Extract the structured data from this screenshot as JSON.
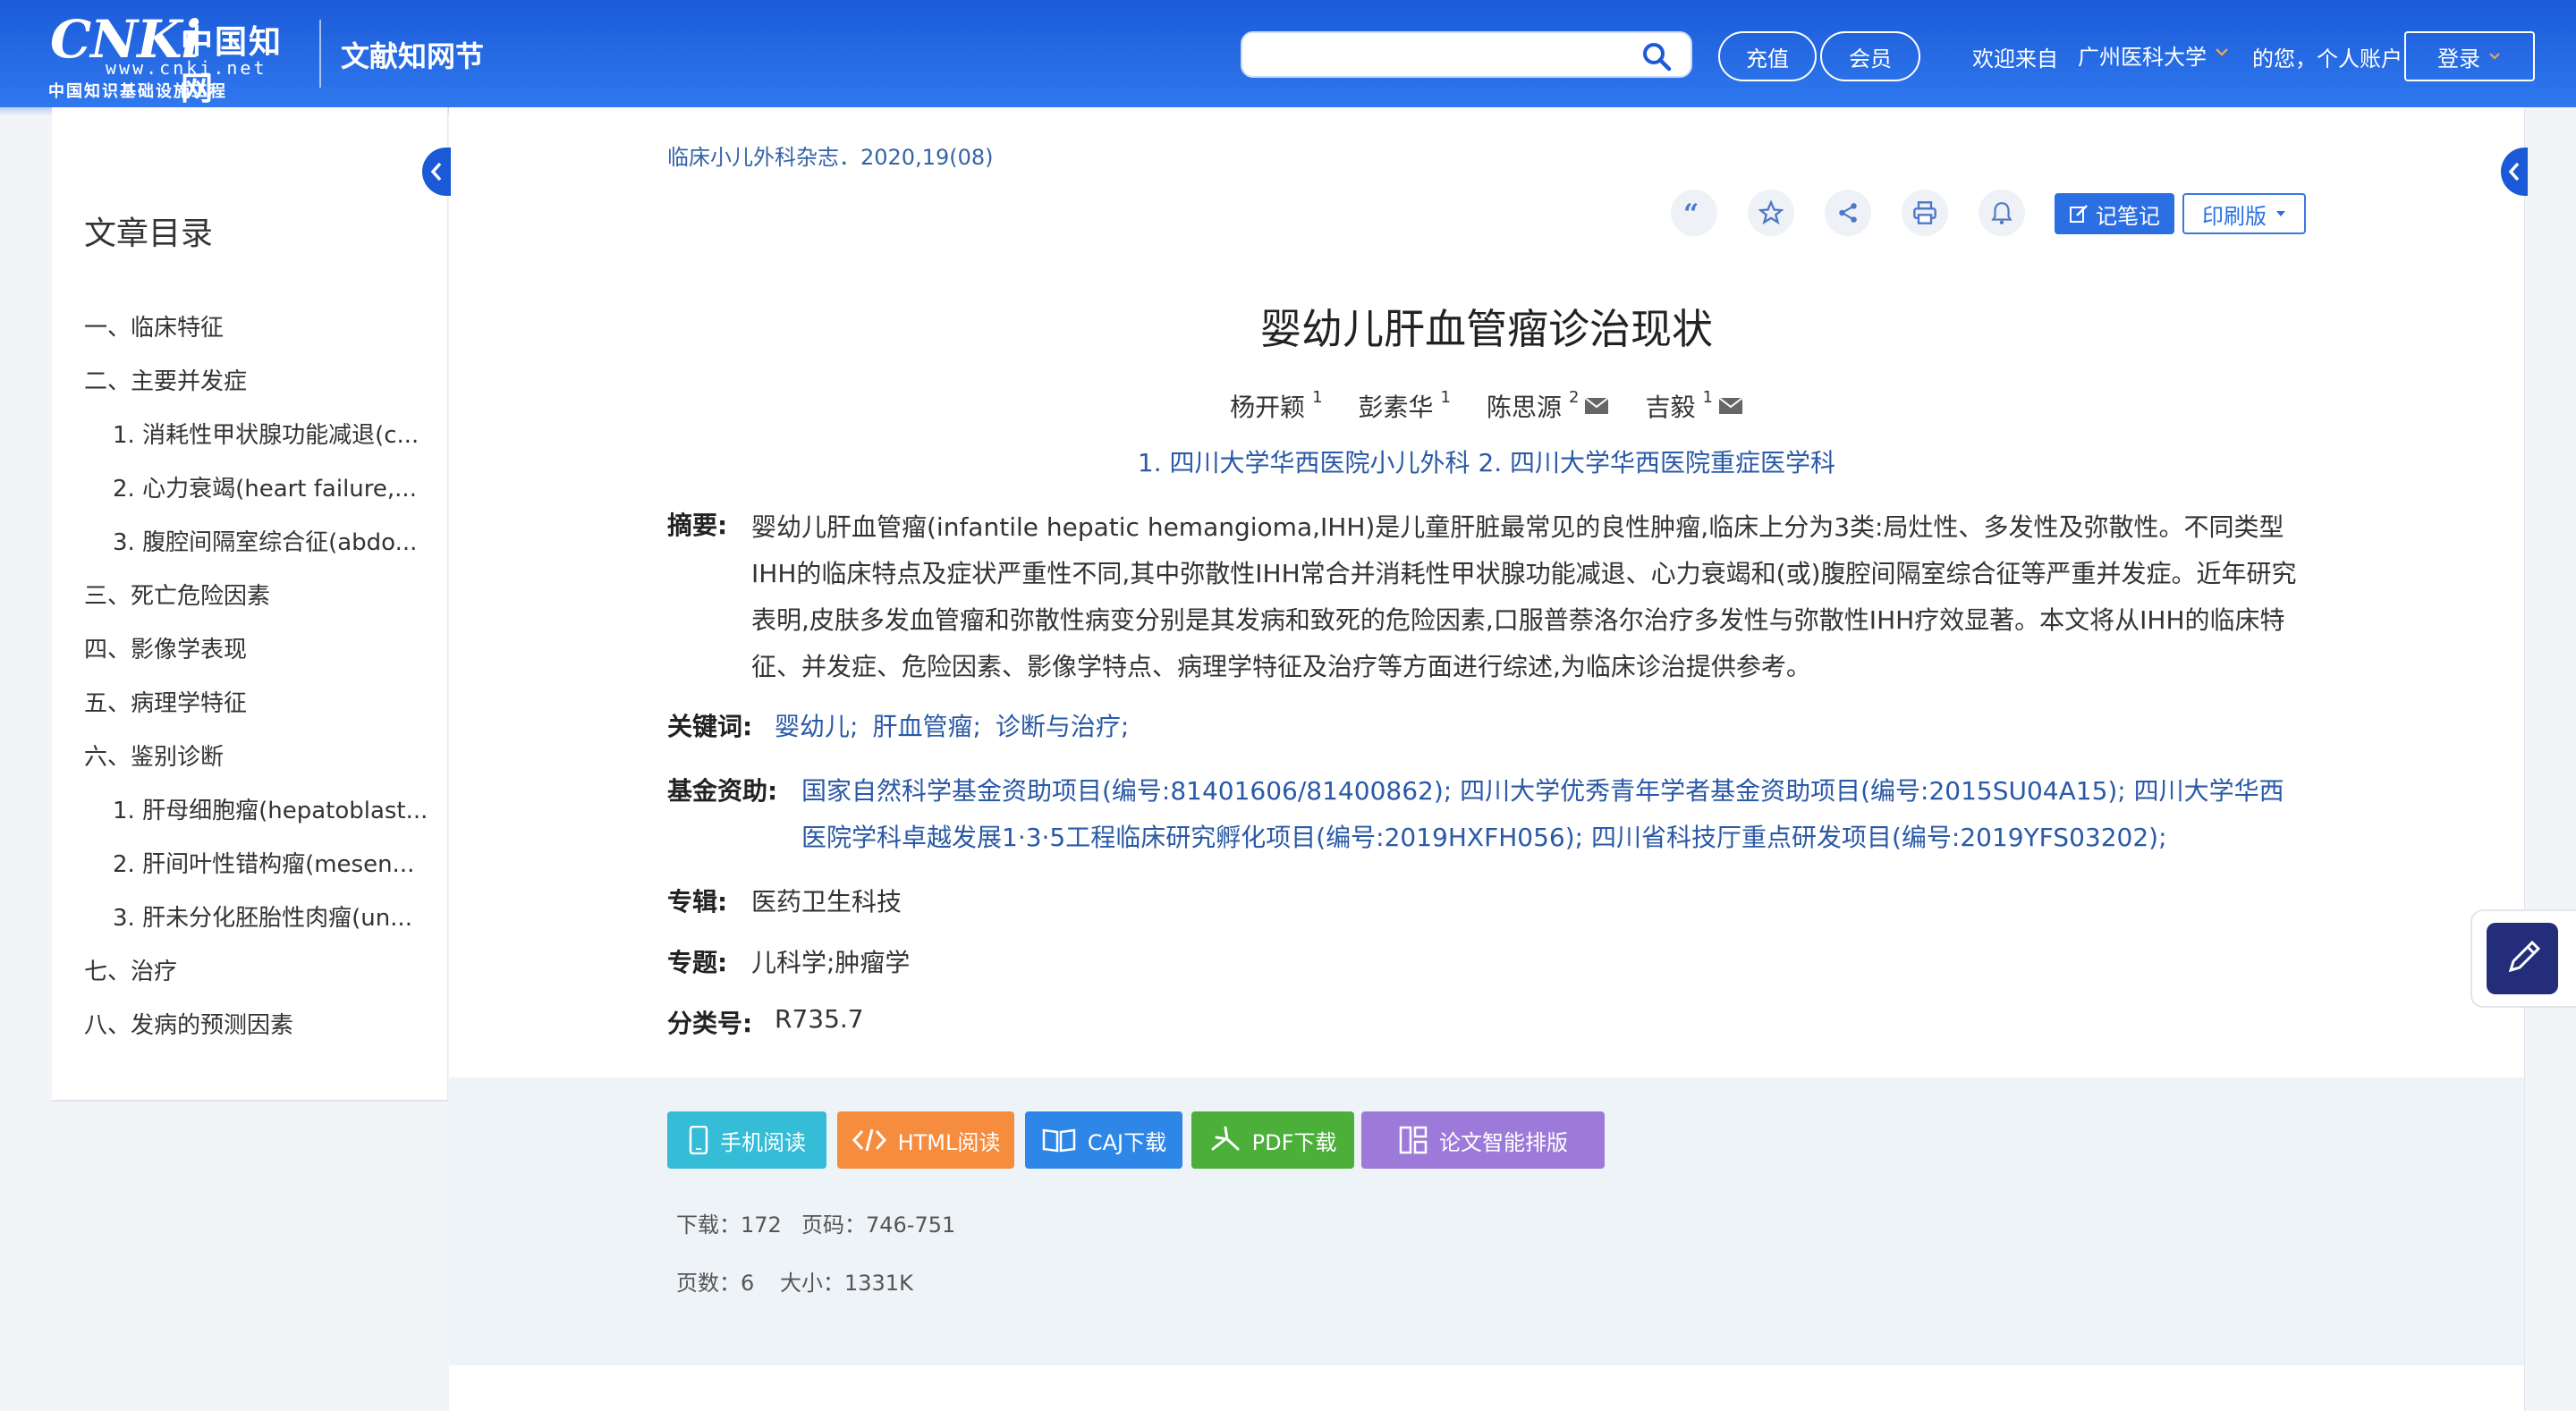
{
  "header": {
    "logo_text": "CNKi",
    "logo_cn": "中国知网",
    "logo_url": "www.cnki.net",
    "logo_sub": "中国知识基础设施工程",
    "site_name": "文献知网节",
    "search_placeholder": "",
    "recharge_label": "充值",
    "member_label": "会员",
    "welcome_text": "欢迎来自",
    "institution": "广州医科大学",
    "greeting": "的您，个人账户",
    "login_label": "登录",
    "colors": {
      "header_bg": "#2a6ce6",
      "accent": "#1b5ad6"
    }
  },
  "toc": {
    "title": "文章目录",
    "items": [
      {
        "label": "一、临床特征",
        "level": 1
      },
      {
        "label": "二、主要并发症",
        "level": 1
      },
      {
        "label": "1.  消耗性甲状腺功能减退(c...",
        "level": 2
      },
      {
        "label": "2.  心力衰竭(heart failure,...",
        "level": 2
      },
      {
        "label": "3.  腹腔间隔室综合征(abdo...",
        "level": 2
      },
      {
        "label": "三、死亡危险因素",
        "level": 1
      },
      {
        "label": "四、影像学表现",
        "level": 1
      },
      {
        "label": "五、病理学特征",
        "level": 1
      },
      {
        "label": "六、鉴别诊断",
        "level": 1
      },
      {
        "label": "1.  肝母细胞瘤(hepatoblast...",
        "level": 2
      },
      {
        "label": "2.  肝间叶性错构瘤(mesen...",
        "level": 2
      },
      {
        "label": "3.  肝未分化胚胎性肉瘤(un...",
        "level": 2
      },
      {
        "label": "七、治疗",
        "level": 1
      },
      {
        "label": "八、发病的预测因素",
        "level": 1
      }
    ]
  },
  "article": {
    "journal": "临床小儿外科杂志．2020,19(08)",
    "title": "婴幼儿肝血管瘤诊治现状",
    "authors": [
      {
        "name": "杨开颖",
        "sup": "1",
        "mail": false
      },
      {
        "name": "彭素华",
        "sup": "1",
        "mail": false
      },
      {
        "name": "陈思源",
        "sup": "2",
        "mail": true
      },
      {
        "name": "吉毅",
        "sup": "1",
        "mail": true
      }
    ],
    "affiliations": "1. 四川大学华西医院小儿外科   2. 四川大学华西医院重症医学科",
    "abstract_label": "摘要:",
    "abstract": "婴幼儿肝血管瘤(infantile hepatic hemangioma,IHH)是儿童肝脏最常见的良性肿瘤,临床上分为3类:局灶性、多发性及弥散性。不同类型IHH的临床特点及症状严重性不同,其中弥散性IHH常合并消耗性甲状腺功能减退、心力衰竭和(或)腹腔间隔室综合征等严重并发症。近年研究表明,皮肤多发血管瘤和弥散性病变分别是其发病和致死的危险因素,口服普萘洛尔治疗多发性与弥散性IHH疗效显著。本文将从IHH的临床特征、并发症、危险因素、影像学特点、病理学特征及治疗等方面进行综述,为临床诊治提供参考。",
    "keywords_label": "关键词:",
    "keywords": [
      "婴幼儿;",
      "肝血管瘤;",
      "诊断与治疗;"
    ],
    "fund_label": "基金资助:",
    "fund": "国家自然科学基金资助项目(编号:81401606/81400862);   四川大学优秀青年学者基金资助项目(编号:2015SU04A15);   四川大学华西医院学科卓越发展1·3·5工程临床研究孵化项目(编号:2019HXFH056);   四川省科技厅重点研发项目(编号:2019YFS03202);",
    "series_label": "专辑:",
    "series": "医药卫生科技",
    "topic_label": "专题:",
    "topic": "儿科学;肿瘤学",
    "class_label": "分类号:",
    "class_no": "R735.7"
  },
  "toolbar": {
    "note_label": "记笔记",
    "print_label": "印刷版"
  },
  "downloads": {
    "mobile": "手机阅读",
    "html": "HTML阅读",
    "caj": "CAJ下载",
    "pdf": "PDF下载",
    "smart": "论文智能排版"
  },
  "stats": {
    "downloads": "下载：172",
    "pages_range": "页码：746-751",
    "page_count": "页数：6",
    "size": "大小：1331K"
  }
}
